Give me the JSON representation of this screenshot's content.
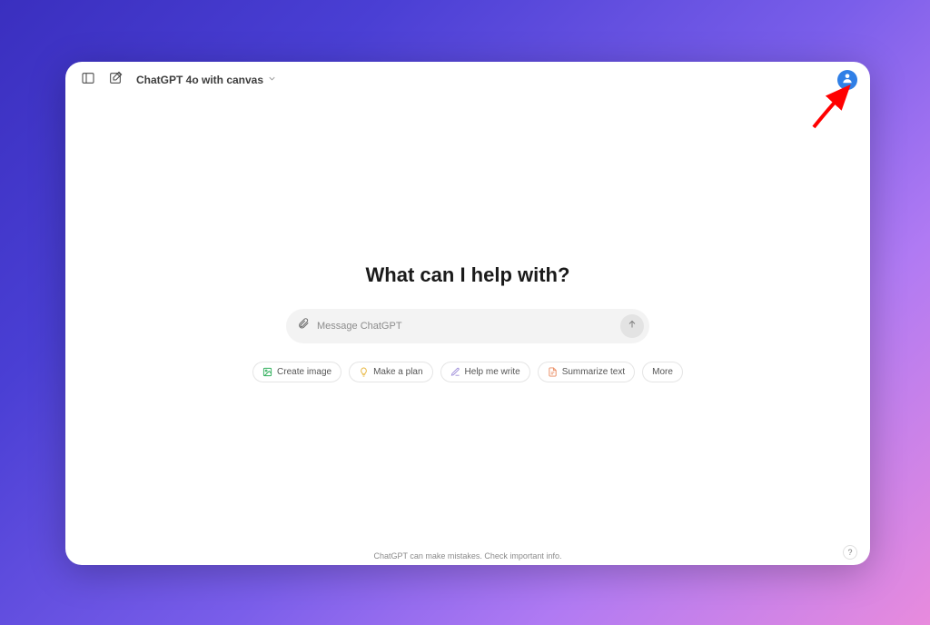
{
  "header": {
    "model_label": "ChatGPT 4o with canvas"
  },
  "main": {
    "headline": "What can I help with?",
    "input_placeholder": "Message ChatGPT"
  },
  "chips": {
    "create_image": "Create image",
    "make_plan": "Make a plan",
    "help_write": "Help me write",
    "summarize": "Summarize text",
    "more": "More"
  },
  "footer": {
    "disclaimer": "ChatGPT can make mistakes. Check important info.",
    "help": "?"
  },
  "icons": {
    "sidebar": "sidebar-toggle-icon",
    "new_chat": "new-chat-icon",
    "chevron": "chevron-down-icon",
    "avatar": "user-avatar-icon",
    "attach": "paperclip-icon",
    "send": "arrow-up-icon",
    "image": "image-icon",
    "bulb": "lightbulb-icon",
    "pencil": "pencil-icon",
    "doc": "document-icon"
  },
  "colors": {
    "chip_image": "#2fae5a",
    "chip_bulb": "#e7b336",
    "chip_pencil": "#9c8bd8",
    "chip_doc": "#ea8a5f",
    "avatar_bg": "#2f7fe6",
    "arrow": "#ff0000"
  }
}
